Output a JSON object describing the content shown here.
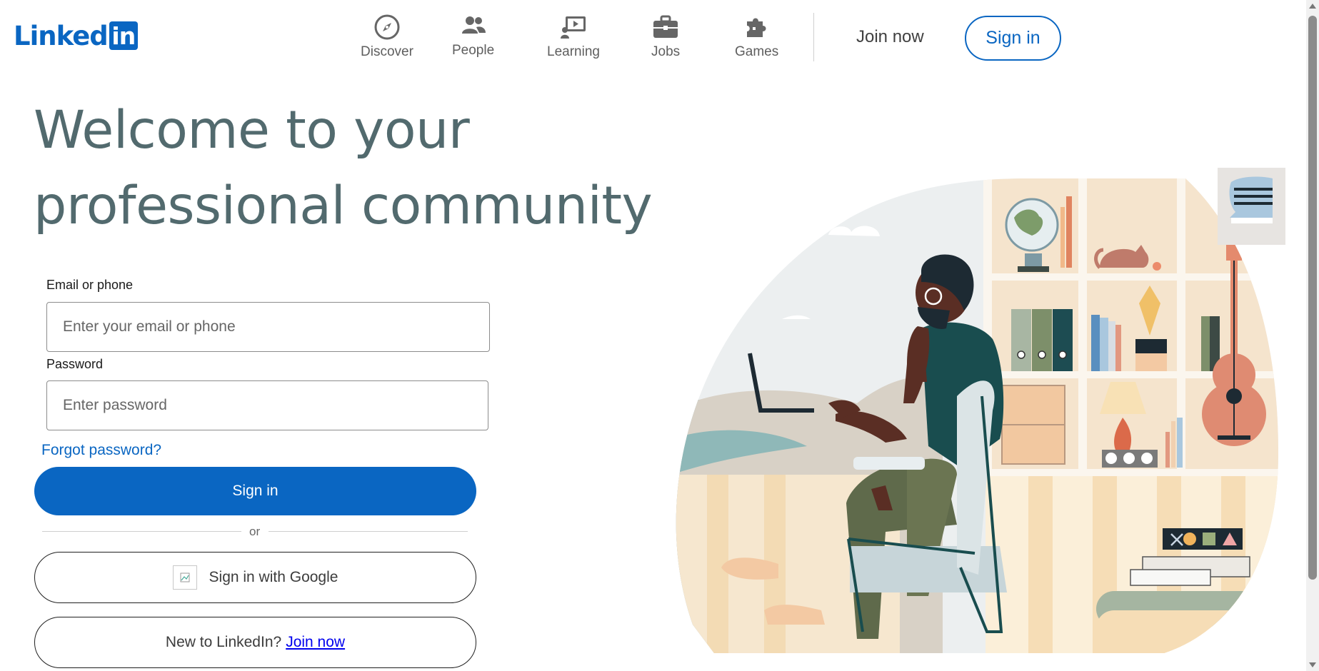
{
  "header": {
    "logo_text": "Linked",
    "logo_box_text": "in",
    "nav": [
      {
        "label": "Discover",
        "icon": "compass-icon"
      },
      {
        "label": "People",
        "icon": "people-icon"
      },
      {
        "label": "Learning",
        "icon": "learning-icon"
      },
      {
        "label": "Jobs",
        "icon": "briefcase-icon"
      },
      {
        "label": "Games",
        "icon": "puzzle-icon"
      }
    ],
    "join_now": "Join now",
    "sign_in": "Sign in"
  },
  "hero": {
    "headline_line1": "Welcome to your",
    "headline_line2": "professional community"
  },
  "form": {
    "email_label": "Email or phone",
    "email_placeholder": "Enter your email or phone",
    "password_label": "Password",
    "password_placeholder": "Enter password",
    "forgot": "Forgot password?",
    "sign_in": "Sign in",
    "or": "or",
    "google": "Sign in with Google",
    "new_prefix": "New to LinkedIn?",
    "join_now": "Join now"
  },
  "colors": {
    "brand": "#0a66c2",
    "headline": "#526a6e"
  }
}
